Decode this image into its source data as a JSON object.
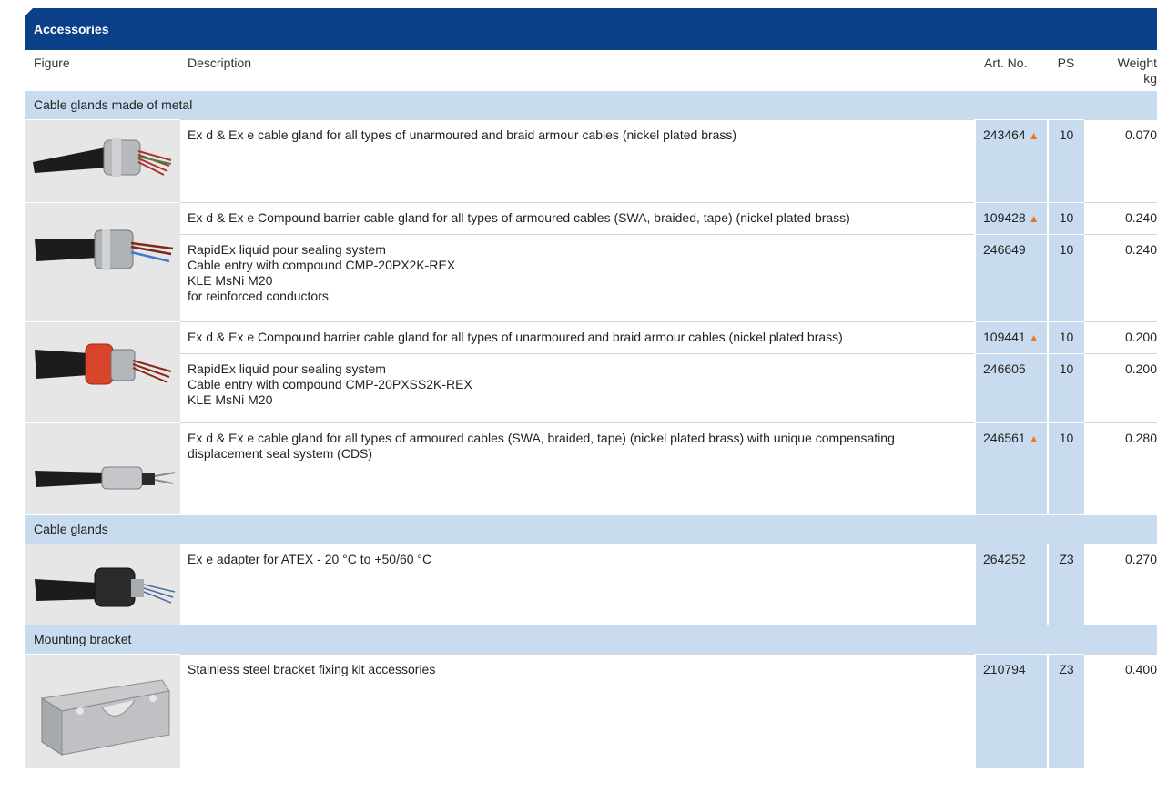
{
  "title": "Accessories",
  "headers": {
    "figure": "Figure",
    "description": "Description",
    "art_no": "Art. No.",
    "ps": "PS",
    "weight_line1": "Weight",
    "weight_line2": "kg"
  },
  "marker_symbol": "▲",
  "sections": [
    {
      "label": "Cable glands made of metal",
      "rows": [
        {
          "description": [
            "Ex d & Ex e cable gland for all types of unarmoured and braid armour cables (nickel plated brass)"
          ],
          "art_no": "243464",
          "marker": true,
          "ps": "10",
          "weight": "0.070"
        },
        {
          "description": [
            "Ex d & Ex e Compound barrier cable gland for all types of armoured cables (SWA, braided, tape) (nickel plated brass)"
          ],
          "art_no": "109428",
          "marker": true,
          "ps": "10",
          "weight": "0.240"
        },
        {
          "description": [
            "RapidEx liquid pour sealing system",
            "Cable entry with compound CMP-20PX2K-REX",
            "KLE MsNi M20",
            "for reinforced conductors"
          ],
          "art_no": "246649",
          "marker": false,
          "ps": "10",
          "weight": "0.240"
        },
        {
          "description": [
            "Ex d & Ex e Compound barrier cable gland for all types of unarmoured and braid armour cables (nickel plated brass)"
          ],
          "art_no": "109441",
          "marker": true,
          "ps": "10",
          "weight": "0.200"
        },
        {
          "description": [
            "RapidEx liquid pour sealing system",
            "Cable entry with compound CMP-20PXSS2K-REX",
            "KLE MsNi M20"
          ],
          "art_no": "246605",
          "marker": false,
          "ps": "10",
          "weight": "0.200"
        },
        {
          "description": [
            "Ex d & Ex e cable gland for all types of armoured cables (SWA, braided, tape) (nickel plated brass) with unique compensating displacement seal system (CDS)"
          ],
          "art_no": "246561",
          "marker": true,
          "ps": "10",
          "weight": "0.280"
        }
      ]
    },
    {
      "label": "Cable glands",
      "rows": [
        {
          "description": [
            "Ex e adapter for ATEX - 20 °C to +50/60 °C"
          ],
          "art_no": "264252",
          "marker": false,
          "ps": "Z3",
          "weight": "0.270"
        }
      ]
    },
    {
      "label": "Mounting bracket",
      "rows": [
        {
          "description": [
            "Stainless steel bracket fixing kit accessories"
          ],
          "art_no": "210794",
          "marker": false,
          "ps": "Z3",
          "weight": "0.400"
        }
      ]
    }
  ],
  "colors": {
    "title_bar": "#0b3f8a",
    "section_band": "#c9dcef",
    "figure_bg": "#e6e6e6",
    "marker": "#e87722"
  },
  "figure_icons": [
    "metal-cable-gland-icon",
    "compound-barrier-gland-icon",
    "red-compound-barrier-gland-icon",
    "cds-cable-gland-icon",
    "ex-e-adapter-icon",
    "stainless-bracket-icon"
  ]
}
